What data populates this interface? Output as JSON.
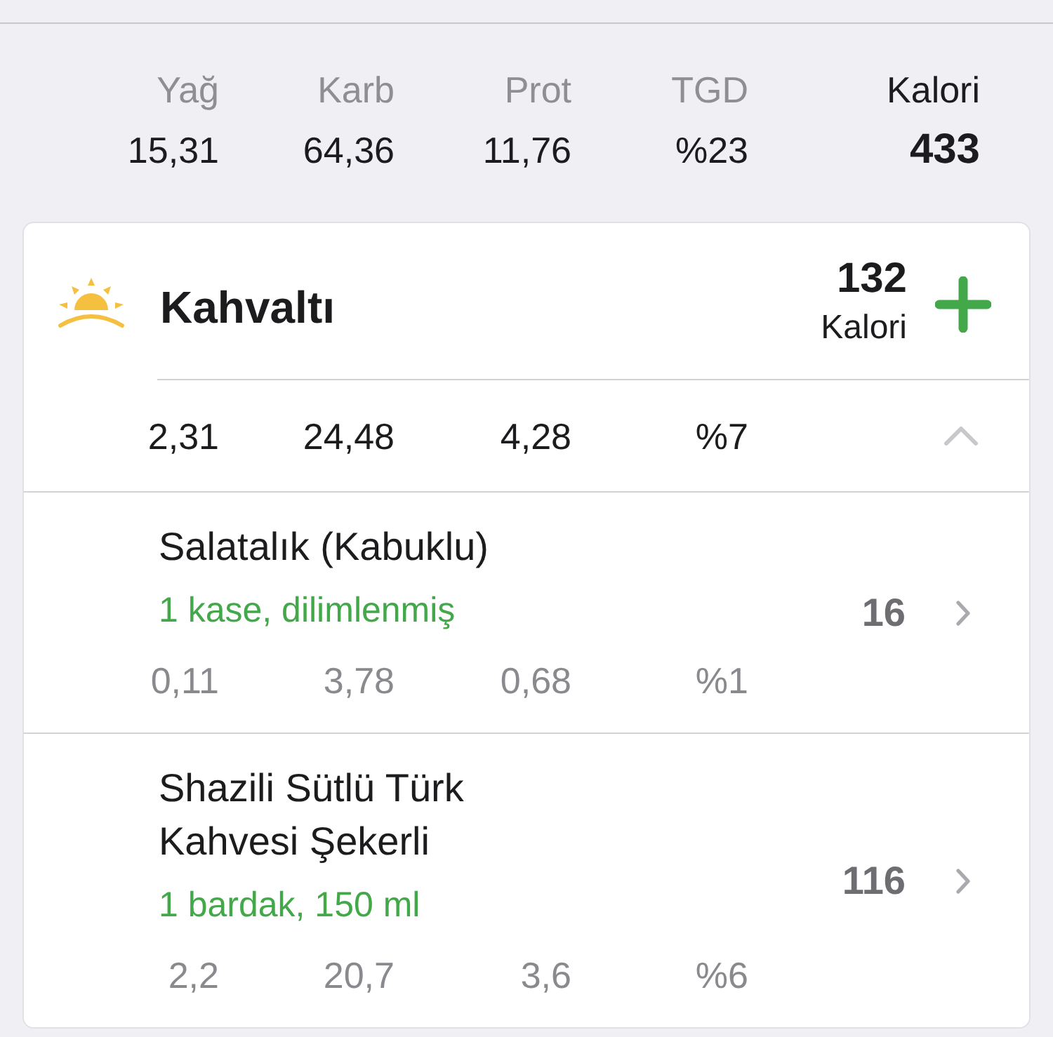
{
  "summary": {
    "columns": [
      {
        "label": "Yağ",
        "value": "15,31"
      },
      {
        "label": "Karb",
        "value": "64,36"
      },
      {
        "label": "Prot",
        "value": "11,76"
      },
      {
        "label": "TGD",
        "value": "%23"
      }
    ],
    "calories": {
      "label": "Kalori",
      "value": "433"
    }
  },
  "meal": {
    "title": "Kahvaltı",
    "calories": "132",
    "calories_label": "Kalori",
    "expanded": true,
    "totals": [
      "2,31",
      "24,48",
      "4,28",
      "%7"
    ],
    "items": [
      {
        "name": "Salatalık (Kabuklu)",
        "serving": "1 kase, dilimlenmiş",
        "calories": "16",
        "macros": [
          "0,11",
          "3,78",
          "0,68",
          "%1"
        ]
      },
      {
        "name": "Shazili Sütlü Türk Kahvesi Şekerli",
        "serving": "1 bardak, 150 ml",
        "calories": "116",
        "macros": [
          "2,2",
          "20,7",
          "3,6",
          "%6"
        ]
      }
    ]
  }
}
